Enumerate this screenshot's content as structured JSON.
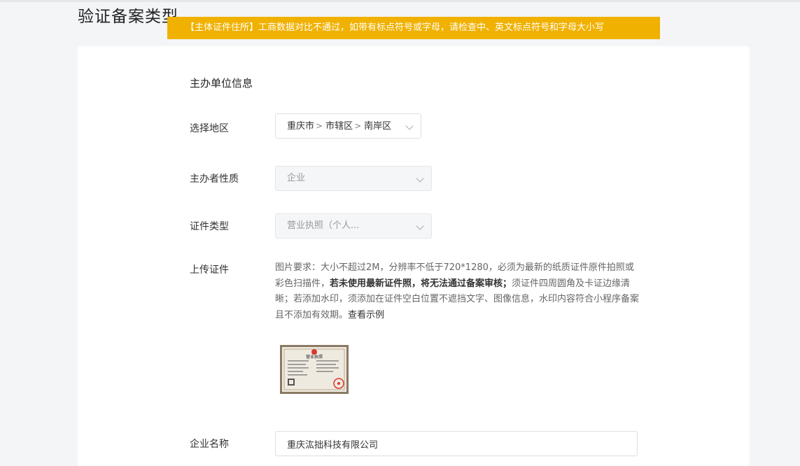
{
  "page": {
    "title": "验证备案类型",
    "toast": "【主体证件住所】工商数据对比不通过，如带有标点符号或字母，请检查中、英文标点符号和字母大小写"
  },
  "form": {
    "section_title": "主办单位信息",
    "region": {
      "label": "选择地区",
      "province": "重庆市",
      "city": "市辖区",
      "district": "南岸区",
      "separator": ">"
    },
    "organizer_type": {
      "label": "主办者性质",
      "value": "企业"
    },
    "certificate_type": {
      "label": "证件类型",
      "value": "营业执照（个人..."
    },
    "upload": {
      "label": "上传证件",
      "desc_1": "图片要求：大小不超过2M，分辨率不低于720*1280，必须为最新的纸质证件原件拍照或彩色扫描件，",
      "desc_bold": "若未使用最新证件照，将无法通过备案审核；",
      "desc_2": "须证件四周圆角及卡证边缘清晰；若添加水印，须添加在证件空白位置不遮挡文字、图像信息，水印内容符合小程序备案且不添加有效期。",
      "example_link": "查看示例",
      "thumb_text": "营业执照"
    },
    "company_name": {
      "label": "企业名称",
      "value": "重庆汯拙科技有限公司"
    }
  },
  "colors": {
    "toast_bg": "#f0b100",
    "seal": "#d8382f"
  }
}
